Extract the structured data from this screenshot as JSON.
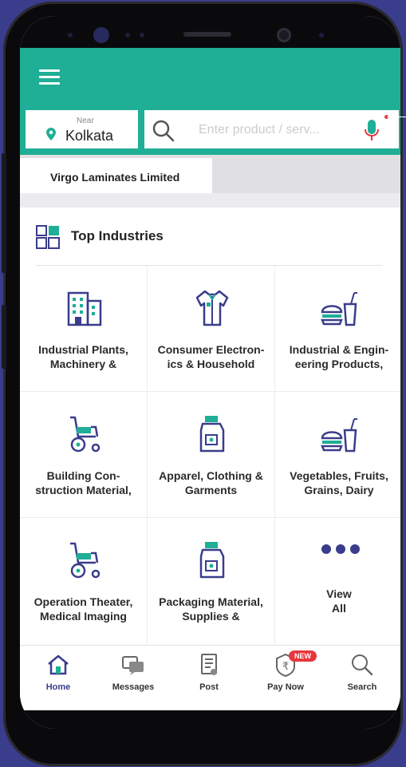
{
  "header": {
    "menu_icon": "hamburger-icon"
  },
  "location": {
    "near_label": "Near",
    "city": "Kolkata",
    "icon": "location-pin-icon"
  },
  "search": {
    "placeholder": "Enter product / serv...",
    "icon": "search-icon",
    "voice_icon": "microphone-icon"
  },
  "recent_chips": [
    {
      "label": "Virgo Laminates Limited"
    }
  ],
  "industries": {
    "title": "Top Industries",
    "icon": "grid-icon",
    "items": [
      {
        "label": "Industrial Plants, Machinery &",
        "icon": "building-icon"
      },
      {
        "label": "Consumer Electron-ics & Household",
        "icon": "shirt-icon"
      },
      {
        "label": "Industrial & Engin-eering Products,",
        "icon": "burger-drink-icon"
      },
      {
        "label": "Building Con-struction Material,",
        "icon": "wheelchair-icon"
      },
      {
        "label": "Apparel, Clothing & Garments",
        "icon": "milk-carton-icon"
      },
      {
        "label": "Vegetables, Fruits, Grains, Dairy",
        "icon": "burger-drink-icon"
      },
      {
        "label": "Operation Theater, Medical Imaging",
        "icon": "wheelchair-icon"
      },
      {
        "label": "Packaging Material, Supplies &",
        "icon": "milk-carton-icon"
      },
      {
        "label": "View All",
        "icon": "more-dots-icon"
      }
    ]
  },
  "bottom_nav": {
    "items": [
      {
        "label": "Home",
        "icon": "home-icon",
        "active": true
      },
      {
        "label": "Messages",
        "icon": "messages-icon"
      },
      {
        "label": "Post",
        "icon": "post-icon"
      },
      {
        "label": "Pay Now",
        "icon": "rupee-icon",
        "badge": "NEW"
      },
      {
        "label": "Search",
        "icon": "search-icon"
      }
    ]
  },
  "colors": {
    "brand": "#1fae96",
    "accent": "#3a3c8c",
    "badge": "#e8363f"
  }
}
